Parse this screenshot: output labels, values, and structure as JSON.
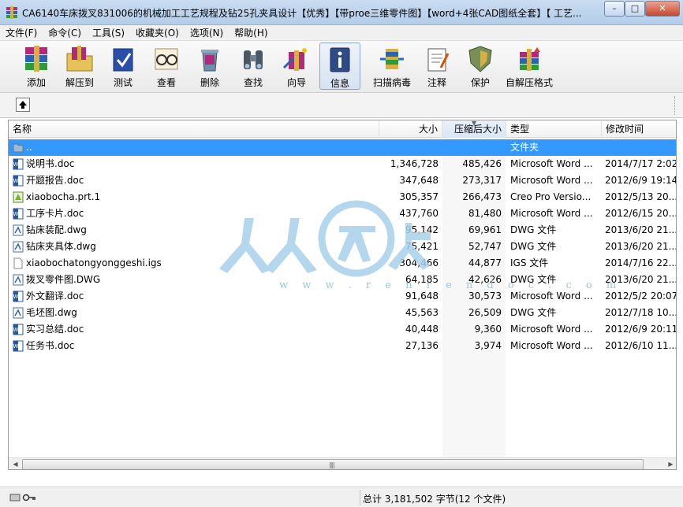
{
  "window": {
    "title": "CA6140车床拨叉831006的机械加工工艺规程及钻25孔夹具设计【优秀】【带proe三维零件图】【word+4张CAD图纸全套】【 工艺...",
    "minimize": "–",
    "maximize": "□",
    "close": "✕"
  },
  "menu": [
    "文件(F)",
    "命令(C)",
    "工具(S)",
    "收藏夹(O)",
    "选项(N)",
    "帮助(H)"
  ],
  "toolbar": {
    "add": "添加",
    "extract": "解压到",
    "test": "测试",
    "view": "查看",
    "delete": "删除",
    "find": "查找",
    "wizard": "向导",
    "info": "信息",
    "scan": "扫描病毒",
    "comment": "注释",
    "protect": "保护",
    "sfx": "自解压格式"
  },
  "columns": {
    "name": "名称",
    "size": "大小",
    "packed": "压缩后大小",
    "type": "类型",
    "modified": "修改时间"
  },
  "rows": [
    {
      "name": "..",
      "size": "",
      "packed": "",
      "type": "文件夹",
      "modified": "",
      "icon": "folder-up-icon"
    },
    {
      "name": "说明书.doc",
      "size": "1,346,728",
      "packed": "485,426",
      "type": "Microsoft Word ...",
      "modified": "2014/7/17 2:02",
      "icon": "word-doc-icon"
    },
    {
      "name": "开题报告.doc",
      "size": "347,648",
      "packed": "273,317",
      "type": "Microsoft Word ...",
      "modified": "2012/6/9 19:14",
      "icon": "word-doc-icon"
    },
    {
      "name": "xiaobocha.prt.1",
      "size": "305,357",
      "packed": "266,473",
      "type": "Creo Pro Versio...",
      "modified": "2012/5/13 20...",
      "icon": "creo-part-icon"
    },
    {
      "name": "工序卡片.doc",
      "size": "437,760",
      "packed": "81,480",
      "type": "Microsoft Word ...",
      "modified": "2012/6/15 20...",
      "icon": "word-doc-icon"
    },
    {
      "name": "钻床装配.dwg",
      "size": "95,142",
      "packed": "69,961",
      "type": "DWG 文件",
      "modified": "2013/6/20 21...",
      "icon": "dwg-file-icon"
    },
    {
      "name": "钻床夹具体.dwg",
      "size": "75,421",
      "packed": "52,747",
      "type": "DWG 文件",
      "modified": "2013/6/20 21...",
      "icon": "dwg-file-icon"
    },
    {
      "name": "xiaobochatongyonggeshi.igs",
      "size": "304,466",
      "packed": "44,877",
      "type": "IGS 文件",
      "modified": "2014/7/16 22...",
      "icon": "blank-file-icon"
    },
    {
      "name": "拨叉零件图.DWG",
      "size": "64,185",
      "packed": "42,626",
      "type": "DWG 文件",
      "modified": "2013/6/20 21...",
      "icon": "dwg-file-icon"
    },
    {
      "name": "外文翻译.doc",
      "size": "91,648",
      "packed": "30,573",
      "type": "Microsoft Word ...",
      "modified": "2012/5/2 20:07",
      "icon": "word-doc-icon"
    },
    {
      "name": "毛坯图.dwg",
      "size": "45,563",
      "packed": "26,509",
      "type": "DWG 文件",
      "modified": "2012/7/18 10...",
      "icon": "dwg-file-icon"
    },
    {
      "name": "实习总结.doc",
      "size": "40,448",
      "packed": "9,360",
      "type": "Microsoft Word ...",
      "modified": "2012/6/9 20:11",
      "icon": "word-doc-icon"
    },
    {
      "name": "任务书.doc",
      "size": "27,136",
      "packed": "3,974",
      "type": "Microsoft Word ...",
      "modified": "2012/6/10 11...",
      "icon": "word-doc-icon"
    }
  ],
  "watermark": {
    "text": "w w w . r e n r e n d o c . c o m"
  },
  "status": {
    "summary": "总计 3,181,502 字节(12 个文件)"
  }
}
